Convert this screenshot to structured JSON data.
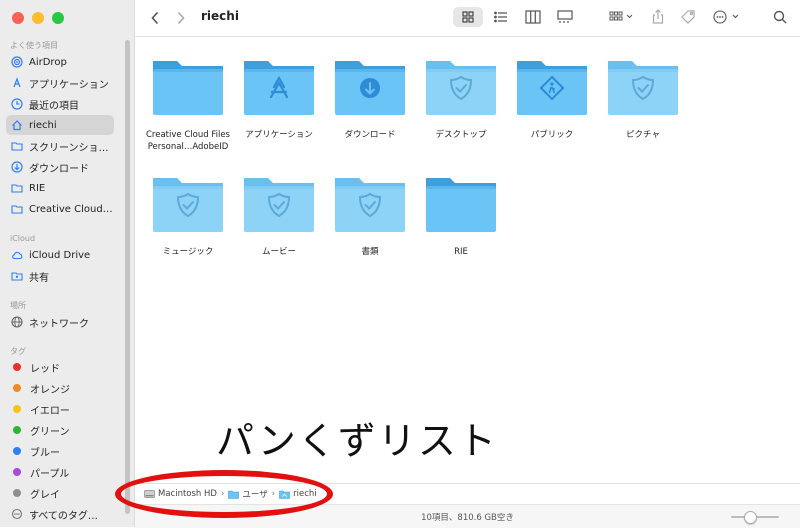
{
  "window": {
    "title": "riechi"
  },
  "sidebar": {
    "favorites_header": "よく使う項目",
    "favorites": [
      {
        "label": "AirDrop",
        "icon": "airdrop-icon"
      },
      {
        "label": "アプリケーション",
        "icon": "applications-icon"
      },
      {
        "label": "最近の項目",
        "icon": "clock-icon"
      },
      {
        "label": "riechi",
        "icon": "home-icon",
        "selected": true
      },
      {
        "label": "スクリーンショ…",
        "icon": "folder-icon"
      },
      {
        "label": "ダウンロード",
        "icon": "download-icon"
      },
      {
        "label": "RIE",
        "icon": "folder-icon"
      },
      {
        "label": "Creative Cloud…",
        "icon": "folder-icon"
      }
    ],
    "icloud_header": "iCloud",
    "icloud": [
      {
        "label": "iCloud Drive",
        "icon": "cloud-icon"
      },
      {
        "label": "共有",
        "icon": "shared-folder-icon"
      }
    ],
    "locations_header": "場所",
    "locations": [
      {
        "label": "ネットワーク",
        "icon": "network-icon"
      }
    ],
    "tags_header": "タグ",
    "tags": [
      {
        "label": "レッド",
        "color": "#e8312a"
      },
      {
        "label": "オレンジ",
        "color": "#f08a24"
      },
      {
        "label": "イエロー",
        "color": "#f5c518"
      },
      {
        "label": "グリーン",
        "color": "#2fb43a"
      },
      {
        "label": "ブルー",
        "color": "#2f7ef5"
      },
      {
        "label": "パープル",
        "color": "#a64cd6"
      },
      {
        "label": "グレイ",
        "color": "#8e8e8e"
      },
      {
        "label": "すべてのタグ…",
        "icon": "all-tags-icon"
      }
    ]
  },
  "folders": [
    {
      "label": "Creative Cloud Files Personal…AdobeID",
      "emblem": "none"
    },
    {
      "label": "アプリケーション",
      "emblem": "app-store"
    },
    {
      "label": "ダウンロード",
      "emblem": "download"
    },
    {
      "label": "デスクトップ",
      "emblem": "shield",
      "light": true
    },
    {
      "label": "パブリック",
      "emblem": "public"
    },
    {
      "label": "ピクチャ",
      "emblem": "shield",
      "light": true
    },
    {
      "label": "ミュージック",
      "emblem": "shield",
      "light": true
    },
    {
      "label": "ムービー",
      "emblem": "shield",
      "light": true
    },
    {
      "label": "書類",
      "emblem": "shield",
      "light": true
    },
    {
      "label": "RIE",
      "emblem": "none"
    }
  ],
  "annotation": {
    "caption": "パンくずリスト"
  },
  "pathbar": {
    "crumbs": [
      "Macintosh HD",
      "ユーザ",
      "riechi"
    ]
  },
  "status": {
    "text": "10項目、810.6 GB空き",
    "zoom_fraction": 0.4
  },
  "colors": {
    "folder": "#6ac4f5",
    "folder_dark": "#3d9fdc",
    "highlight": "#e31010"
  }
}
